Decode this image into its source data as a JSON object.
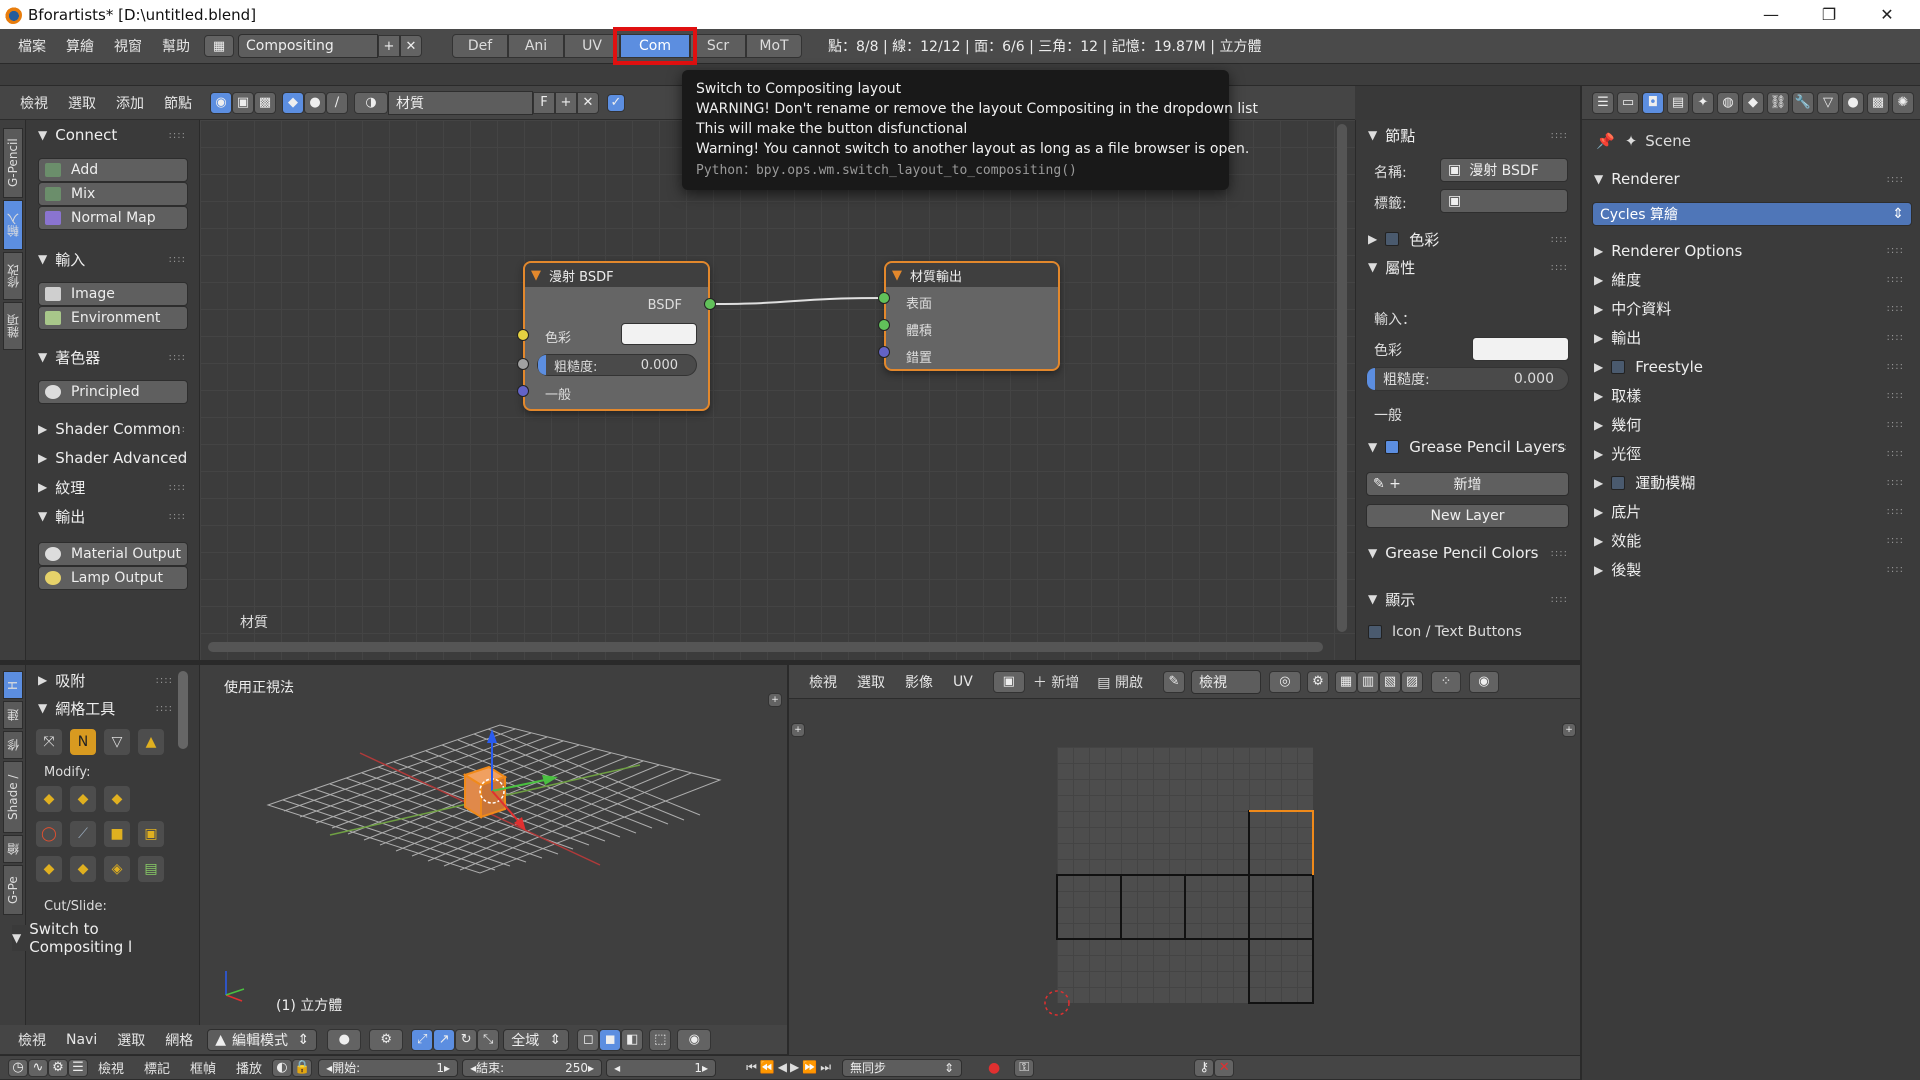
{
  "window": {
    "title": "Bforartists* [D:\\untitled.blend]",
    "minimize": "—",
    "restore": "❐",
    "close": "✕"
  },
  "topbar": {
    "menus": [
      "檔案",
      "算繪",
      "視窗",
      "幫助"
    ],
    "layout_value": "Compositing",
    "tabs": [
      "Def",
      "Ani",
      "UV",
      "Com",
      "Scr",
      "MoT"
    ],
    "active_tab": "Com",
    "stats": "點：8/8 | 線：12/12 | 面：6/6 | 三角：12 | 記憶：19.87M | 立方體"
  },
  "tooltip": {
    "title": "Switch to Compositing layout",
    "line1": "WARNING! Don't rename or remove the layout Compositing in the dropdown list",
    "line2": "This will make the button disfunctional",
    "line3": "Warning! You cannot switch to another layout as long as a file browser is open.",
    "python": "Python：bpy.ops.wm.switch_layout_to_compositing()"
  },
  "node_header": {
    "menus": [
      "檢視",
      "選取",
      "添加",
      "節點"
    ],
    "material_field": "材質",
    "f_label": "F"
  },
  "node_sidebar": {
    "tabs": [
      "G-Pencil",
      "輸入",
      "修改",
      "雜項"
    ],
    "sections": [
      {
        "title": "Connect",
        "items": [
          "Add",
          "Mix",
          "Normal Map"
        ]
      },
      {
        "title": "輸入",
        "items": [
          "Image",
          "Environment"
        ]
      },
      {
        "title": "著色器",
        "items": [
          "Principled"
        ]
      },
      {
        "title": "Shader Common",
        "collapsed": true
      },
      {
        "title": "Shader Advanced",
        "collapsed": true
      },
      {
        "title": "紋理",
        "collapsed": true
      },
      {
        "title": "輸出",
        "items": [
          "Material Output",
          "Lamp Output"
        ]
      }
    ]
  },
  "nodes": {
    "bsdf": {
      "title": "漫射 BSDF",
      "output": "BSDF",
      "color_label": "色彩",
      "rough_label": "粗糙度:",
      "rough_value": "0.000",
      "normal_label": "一般"
    },
    "output": {
      "title": "材質輸出",
      "surface": "表面",
      "volume": "體積",
      "displacement": "錯置"
    },
    "editor_label": "材質"
  },
  "node_props": {
    "node_section": "節點",
    "name_label": "名稱:",
    "name_value": "漫射 BSDF",
    "label_label": "標籤:",
    "color_section": "色彩",
    "props_section": "屬性",
    "inputs_label": "輸入：",
    "color_label": "色彩",
    "rough_label": "粗糙度:",
    "rough_value": "0.000",
    "normal_label": "一般",
    "gp_layers": "Grease Pencil Layers",
    "new_label": "新增",
    "new_layer": "New Layer",
    "gp_colors": "Grease Pencil Colors",
    "display_section": "顯示",
    "icon_text": "Icon / Text Buttons"
  },
  "properties": {
    "scene": "Scene",
    "renderer_section": "Renderer",
    "engine": "Cycles 算繪",
    "sections": [
      "Renderer Options",
      "維度",
      "中介資料",
      "輸出",
      "Freestyle",
      "取樣",
      "幾何",
      "光徑",
      "運動模糊",
      "底片",
      "效能",
      "後製"
    ]
  },
  "tool_shelf": {
    "tabs": [
      "H",
      "建",
      "修",
      "Shade /",
      "繪",
      "G-Pe"
    ],
    "snap": "吸附",
    "mesh_tools": "網格工具",
    "modify": "Modify:",
    "cutslide": "Cut/Slide:",
    "switch_label": "Switch to Compositing l"
  },
  "viewport": {
    "view_label": "使用正視法",
    "object_label": "(1) 立方體"
  },
  "uv_header": {
    "menus": [
      "檢視",
      "選取",
      "影像",
      "UV"
    ],
    "new_label": "新增",
    "open_label": "開啟",
    "view_label": "檢視"
  },
  "bottom": {
    "menus": [
      "檢視",
      "Navi",
      "選取",
      "網格"
    ],
    "mode": "編輯模式",
    "pivot": "全域",
    "timeline_menus": [
      "檢視",
      "標記",
      "框幀",
      "播放"
    ],
    "start_label": "開始:",
    "start_value": "1",
    "end_label": "結束:",
    "end_value": "250",
    "current": "1",
    "sync": "無同步"
  }
}
